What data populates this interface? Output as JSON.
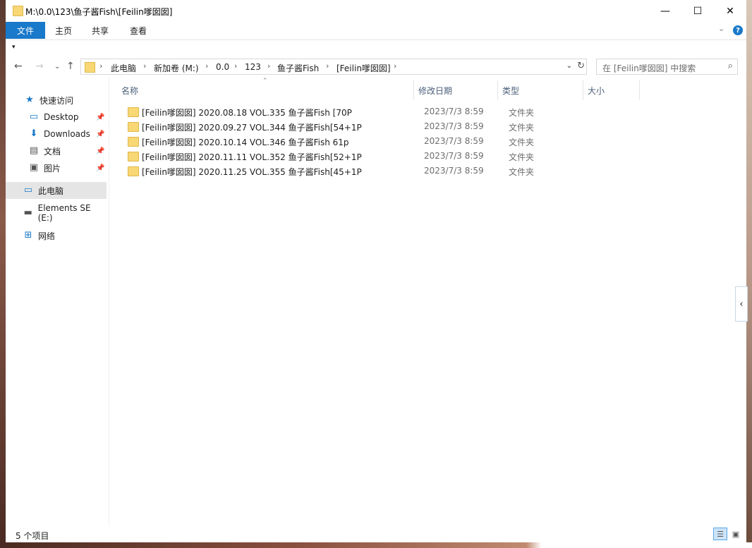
{
  "window": {
    "title": "M:\\0.0\\123\\鱼子酱Fish\\[Feilin嗲囡囡]",
    "controls": {
      "minimize": "—",
      "maximize": "☐",
      "close": "✕"
    }
  },
  "ribbon": {
    "tabs": [
      "文件",
      "主页",
      "共享",
      "查看"
    ]
  },
  "nav": {
    "breadcrumbs": [
      "此电脑",
      "新加卷 (M:)",
      "0.0",
      "123",
      "鱼子酱Fish",
      "[Feilin嗲囡囡]"
    ],
    "search_placeholder": "在 [Feilin嗲囡囡] 中搜索"
  },
  "sidebar": {
    "items": [
      {
        "label": "快速访问",
        "icon": "star-icon"
      },
      {
        "label": "Desktop",
        "icon": "desktop-icon",
        "pinned": true
      },
      {
        "label": "Downloads",
        "icon": "download-icon",
        "pinned": true
      },
      {
        "label": "文档",
        "icon": "document-icon",
        "pinned": true
      },
      {
        "label": "图片",
        "icon": "picture-icon",
        "pinned": true
      },
      {
        "label": "此电脑",
        "icon": "computer-icon",
        "selected": true
      },
      {
        "label": "Elements SE (E:)",
        "icon": "drive-icon"
      },
      {
        "label": "网络",
        "icon": "network-icon"
      }
    ]
  },
  "columns": {
    "name": "名称",
    "date": "修改日期",
    "type": "类型",
    "size": "大小"
  },
  "files": [
    {
      "name": "[Feilin嗲囡囡] 2020.08.18 VOL.335 鱼子酱Fish [70P",
      "date": "2023/7/3 8:59",
      "type": "文件夹"
    },
    {
      "name": "[Feilin嗲囡囡] 2020.09.27 VOL.344 鱼子酱Fish[54+1P",
      "date": "2023/7/3 8:59",
      "type": "文件夹"
    },
    {
      "name": "[Feilin嗲囡囡] 2020.10.14 VOL.346 鱼子酱Fish 61p",
      "date": "2023/7/3 8:59",
      "type": "文件夹"
    },
    {
      "name": "[Feilin嗲囡囡] 2020.11.11 VOL.352 鱼子酱Fish[52+1P",
      "date": "2023/7/3 8:59",
      "type": "文件夹"
    },
    {
      "name": "[Feilin嗲囡囡] 2020.11.25 VOL.355 鱼子酱Fish[45+1P",
      "date": "2023/7/3 8:59",
      "type": "文件夹"
    }
  ],
  "status": {
    "count_text": "5 个项目"
  },
  "colors": {
    "accent": "#1979ca",
    "folder": "#f8d775",
    "selected_bg": "#e5e5e5"
  }
}
